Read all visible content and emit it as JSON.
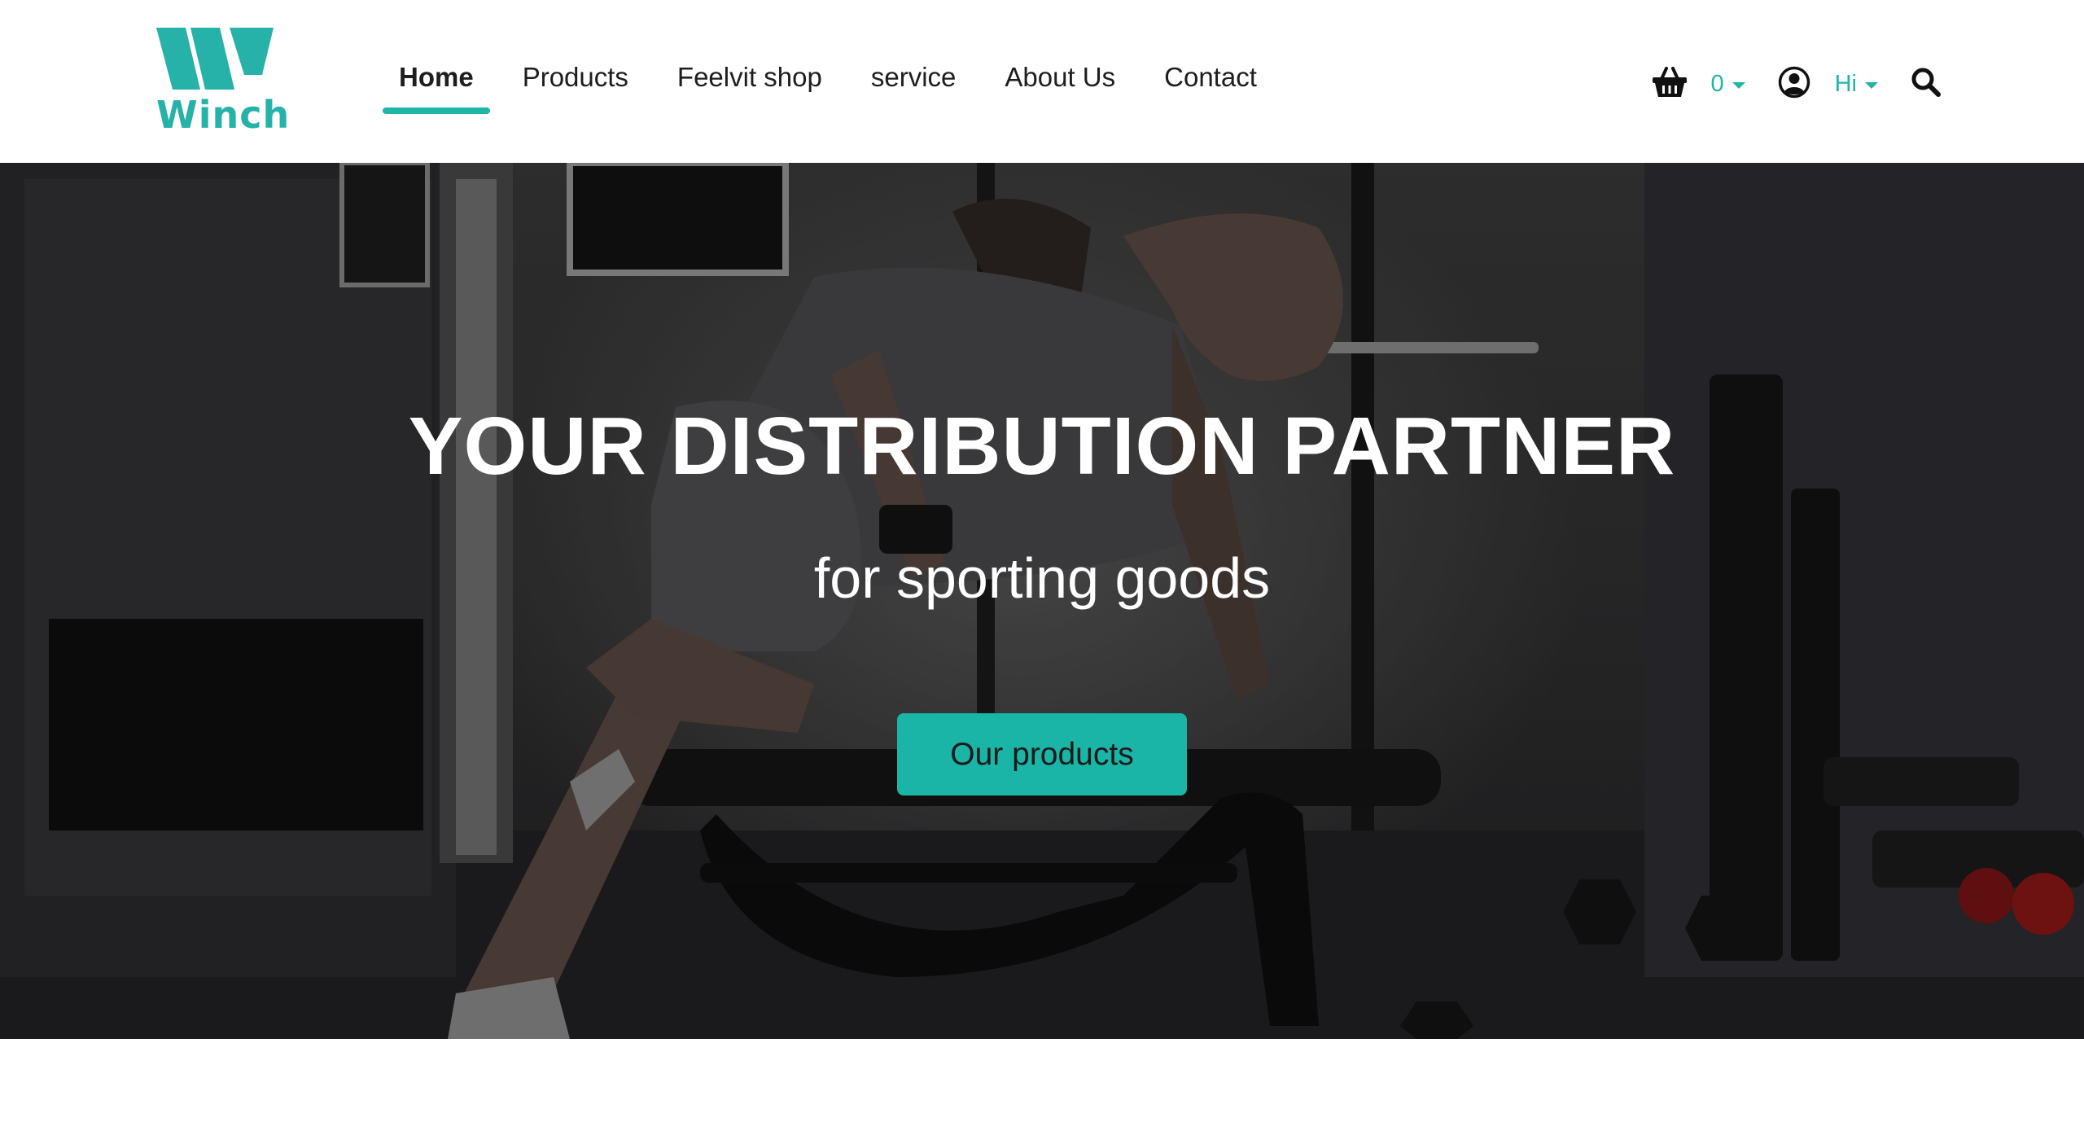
{
  "brand": {
    "name": "Winch",
    "accent_color": "#1fb5a7"
  },
  "nav": {
    "items": [
      {
        "label": "Home",
        "active": true
      },
      {
        "label": "Products",
        "active": false
      },
      {
        "label": "Feelvit shop",
        "active": false
      },
      {
        "label": "service",
        "active": false
      },
      {
        "label": "About Us",
        "active": false
      },
      {
        "label": "Contact",
        "active": false
      }
    ]
  },
  "tools": {
    "cart_icon": "shopping-basket-icon",
    "cart_count": "0",
    "account_icon": "user-circle-icon",
    "greeting": "Hi",
    "search_icon": "search-icon"
  },
  "hero": {
    "title": "YOUR DISTRIBUTION PARTNER",
    "subtitle": "for sporting goods",
    "button_label": "Our products"
  }
}
